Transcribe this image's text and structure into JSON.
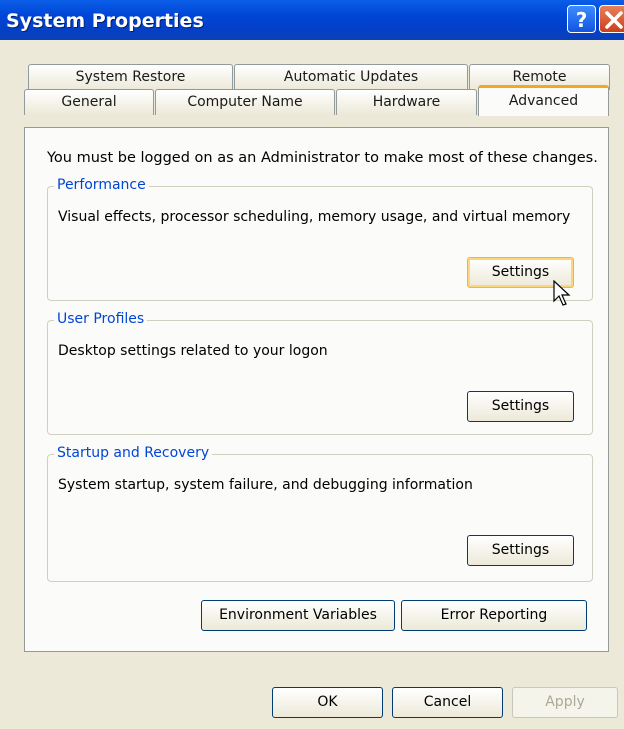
{
  "window": {
    "title": "System Properties"
  },
  "title_buttons": {
    "help": "?"
  },
  "tabs": {
    "back": [
      "System Restore",
      "Automatic Updates",
      "Remote"
    ],
    "front": [
      "General",
      "Computer Name",
      "Hardware",
      "Advanced"
    ],
    "active": "Advanced"
  },
  "advanced": {
    "intro": "You must be logged on as an Administrator to make most of these changes.",
    "performance": {
      "title": "Performance",
      "description": "Visual effects, processor scheduling, memory usage, and virtual memory",
      "button": "Settings"
    },
    "user_profiles": {
      "title": "User Profiles",
      "description": "Desktop settings related to your logon",
      "button": "Settings"
    },
    "startup_recovery": {
      "title": "Startup and Recovery",
      "description": "System startup, system failure, and debugging information",
      "button": "Settings"
    },
    "env_button": "Environment Variables",
    "error_button": "Error Reporting"
  },
  "footer": {
    "ok": "OK",
    "cancel": "Cancel",
    "apply": "Apply"
  },
  "colors": {
    "accent_tab": "#f5a623",
    "group_title": "#0046d5",
    "titlebar": "#0045d6"
  }
}
